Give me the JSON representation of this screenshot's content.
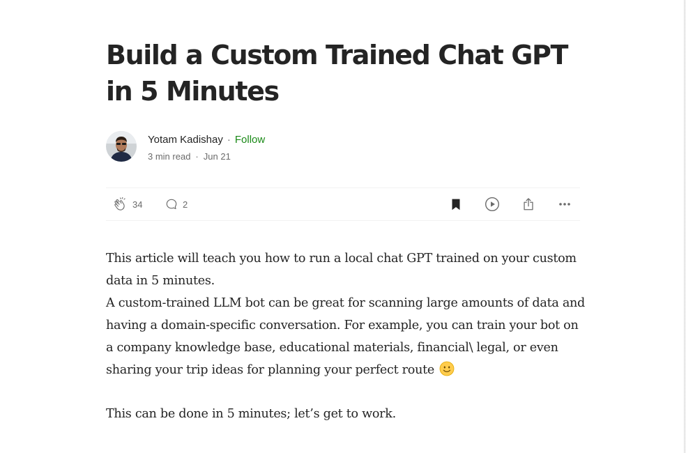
{
  "article": {
    "title": "Build a Custom Trained Chat GPT in 5 Minutes",
    "author": {
      "name": "Yotam Kadishay",
      "follow_label": "Follow",
      "separator": "·"
    },
    "meta": {
      "read_time": "3 min read",
      "date": "Jun 21",
      "separator": "·"
    },
    "actions": {
      "claps": "34",
      "responses": "2"
    },
    "paragraphs": [
      "This article will teach you how to run a local chat GPT trained on your custom data in 5 minutes.",
      "A custom-trained LLM bot can be great for scanning large amounts of data and having a domain-specific conversation. For example, you can train your bot on a company knowledge base, educational materials, financial\\ legal, or even sharing your trip ideas for planning your perfect route",
      "This can be done in 5 minutes; let’s get to work."
    ],
    "emoji": "slightly-smiling-face"
  },
  "colors": {
    "text": "#242424",
    "muted": "#6b6b6b",
    "follow": "#1a8917",
    "divider": "#f2f2f2"
  },
  "icons": {
    "clap": "clap-icon",
    "response": "speech-bubble-icon",
    "save": "bookmark-icon",
    "listen": "play-icon",
    "share": "share-icon",
    "more": "more-dots-icon"
  }
}
